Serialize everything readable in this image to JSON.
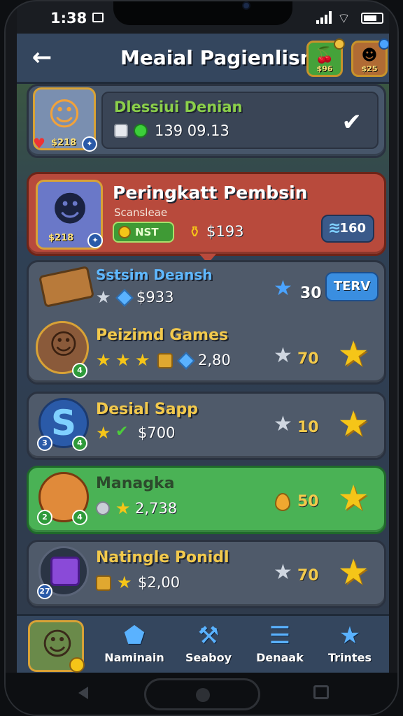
{
  "status_bar": {
    "time": "1:38"
  },
  "header": {
    "title": "Meaial Pagienlisn",
    "fruit_badge": "$96",
    "avatar_badge": "$25"
  },
  "cards": [
    {
      "name": "Dlessiui Denian",
      "avatar_badge": "$218",
      "value": "139 09.13"
    },
    {
      "name": "Peringkatt Pembsin",
      "subtitle": "Scansleae",
      "avatar_badge": "$218",
      "pill": "NST",
      "value": "$193",
      "button": "160"
    },
    {
      "name": "Sstsim Deansh",
      "value": "$933",
      "score": "30",
      "button": "TERV"
    },
    {
      "name": "Peizimd Games",
      "value": "2,80",
      "score": "70"
    },
    {
      "name": "Desial Sapp",
      "value": "$700",
      "score": "10"
    },
    {
      "name": "Managka",
      "value": "2,738",
      "score": "50"
    },
    {
      "name": "Natingle Ponidl",
      "value": "$2,00",
      "score": "70"
    }
  ],
  "bottom_nav": [
    {
      "label": "Naminain",
      "icon": "shield-icon"
    },
    {
      "label": "Seaboy",
      "icon": "tools-icon"
    },
    {
      "label": "Denaak",
      "icon": "stack-icon"
    },
    {
      "label": "Trintes",
      "icon": "star-icon"
    }
  ],
  "colors": {
    "accent_gold": "#f5c518",
    "highlight_red": "#b84a3c",
    "highlight_green": "#4ab255",
    "button_blue": "#3a8ee0"
  }
}
